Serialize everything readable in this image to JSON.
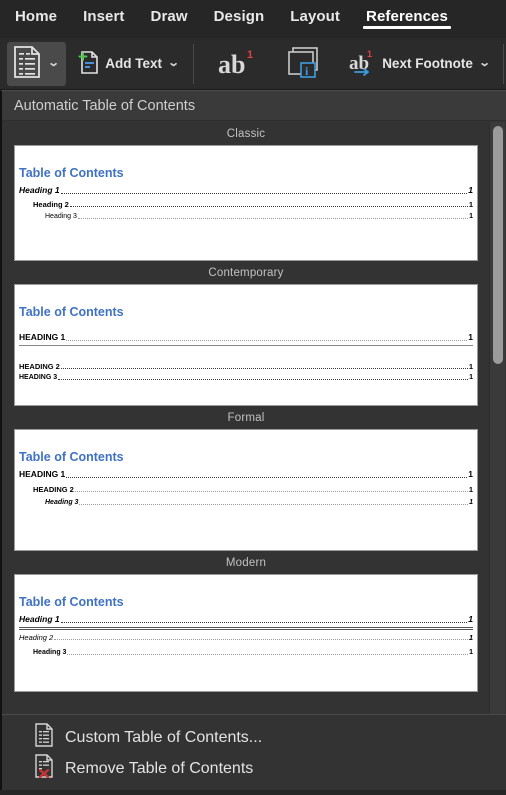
{
  "ribbon": {
    "tabs": [
      {
        "label": "Home",
        "active": false
      },
      {
        "label": "Insert",
        "active": false
      },
      {
        "label": "Draw",
        "active": false
      },
      {
        "label": "Design",
        "active": false
      },
      {
        "label": "Layout",
        "active": false
      },
      {
        "label": "References",
        "active": true
      }
    ],
    "toolbar": {
      "toc_button": {
        "icon": "table-of-contents-icon",
        "chevron": "⌄"
      },
      "add_text": {
        "label": "Add Text",
        "icon": "add-text-icon",
        "chevron": "⌄"
      },
      "footnote": {
        "label": "ab",
        "superscript": "1",
        "icon": "insert-footnote-icon"
      },
      "endnote": {
        "label": "i",
        "icon": "insert-endnote-icon"
      },
      "next_footnote": {
        "label": "Next Footnote",
        "glyph": "ab",
        "superscript": "1",
        "chevron": "⌄"
      }
    }
  },
  "dropdown": {
    "header": "Automatic Table of Contents",
    "styles": [
      {
        "name": "Classic",
        "title": "Table of Contents",
        "entries": [
          {
            "text": "Heading 1",
            "page": "1",
            "level": 1,
            "style": "bold-italic",
            "indent": 0,
            "leader": "dark"
          },
          {
            "text": "Heading 2",
            "page": "1",
            "level": 2,
            "style": "bold",
            "indent": 1,
            "leader": "dark"
          },
          {
            "text": "Heading 3",
            "page": "1",
            "level": 3,
            "style": "regular",
            "indent": 2,
            "leader": "light"
          }
        ]
      },
      {
        "name": "Contemporary",
        "title": "Table of Contents",
        "entries": [
          {
            "text": "Heading 1",
            "page": "1",
            "level": 1,
            "style": "bold-caps",
            "indent": 0,
            "leader": "light",
            "rule": "single"
          },
          {
            "text": "Heading 2",
            "page": "1",
            "level": 2,
            "style": "bold-smallcaps",
            "indent": 0,
            "leader": "dark"
          },
          {
            "text": "Heading 3",
            "page": "1",
            "level": 3,
            "style": "smallcaps",
            "indent": 0,
            "leader": "dark"
          }
        ]
      },
      {
        "name": "Formal",
        "title": "Table of Contents",
        "entries": [
          {
            "text": "Heading 1",
            "page": "1",
            "level": 1,
            "style": "bold-caps",
            "indent": 0,
            "leader": "dark"
          },
          {
            "text": "Heading 2",
            "page": "1",
            "level": 2,
            "style": "bold-smallcaps",
            "indent": 1,
            "leader": "light"
          },
          {
            "text": "Heading 3",
            "page": "1",
            "level": 3,
            "style": "italic",
            "indent": 2,
            "leader": "light"
          }
        ]
      },
      {
        "name": "Modern",
        "title": "Table of Contents",
        "entries": [
          {
            "text": "Heading 1",
            "page": "1",
            "level": 1,
            "style": "bold-italic",
            "indent": 0,
            "leader": "dark",
            "rule": "double"
          },
          {
            "text": "Heading 2",
            "page": "1",
            "level": 2,
            "style": "italic",
            "indent": 0,
            "leader": "light"
          },
          {
            "text": "Heading 3",
            "page": "1",
            "level": 3,
            "style": "regular",
            "indent": 1,
            "leader": "light"
          }
        ]
      }
    ],
    "menu": [
      {
        "label": "Custom Table of Contents...",
        "icon": "document-lines-icon"
      },
      {
        "label": "Remove Table of Contents",
        "icon": "document-remove-icon"
      }
    ]
  },
  "colors": {
    "ribbon_bg": "#262626",
    "toolbar_bg": "#2b2b2b",
    "panel_bg": "#333333",
    "panel_head_bg": "#3a3a3a",
    "accent_blue": "#3f72c4",
    "remove_red": "#cc3333",
    "add_green": "#4ec94e",
    "text_light": "#e6e6e6",
    "scroll_thumb": "#9b9b9b"
  },
  "scrollbar": {
    "position": "top",
    "thumb_fraction": "0.38"
  }
}
